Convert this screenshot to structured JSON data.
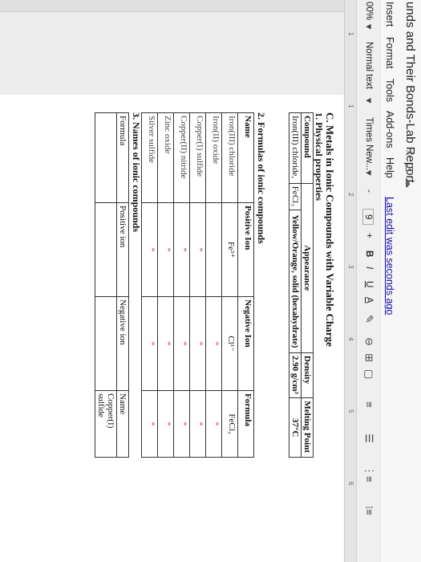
{
  "title_bar": {
    "doc_title": "unds and Their Bonds-Lab Report",
    "icons": [
      "star-icon",
      "move-to-folder-icon",
      "cloud-status-icon"
    ]
  },
  "menu": {
    "items": [
      "Insert",
      "Format",
      "Tools",
      "Add-ons",
      "Help"
    ],
    "last_edit": "Last edit was seconds ago"
  },
  "toolbar": {
    "zoom": "00%",
    "style": "Normal text",
    "font": "Times New...",
    "minus": "-",
    "font_size": "9",
    "plus": "+",
    "bold": "B",
    "italic": "I",
    "underline": "U",
    "text_color": "A"
  },
  "ruler": {
    "ticks": [
      "1",
      "1",
      "2",
      "3",
      "4",
      "5",
      "6"
    ]
  },
  "section": {
    "title": "C. Metals in Ionic Compounds with Variable Charge",
    "physical_title": "1. Physical properties",
    "physical_headers": [
      "Compound",
      "Appearance",
      "Density",
      "Melting Point"
    ],
    "physical_row": {
      "compound": "Iron(III) chloride,",
      "formula": "FeCl₃",
      "appearance": "Yellow/Orange, solid (hexahydrate)",
      "density": "2.90 g/cm³",
      "melting_point": "37°C"
    },
    "formulas_title": "2. Formulas of ionic compounds",
    "formulas_headers": [
      "Name",
      "Positive Ion",
      "Negative Ion",
      "Formula"
    ],
    "formulas_rows": [
      {
        "name": "Iron(III) chloride",
        "pos": "Fe³⁺",
        "neg": "Cl¹⁻",
        "formula": "FeCl₃"
      },
      {
        "name": "Iron(II) oxide",
        "pos": "",
        "neg": "*",
        "formula": "*"
      },
      {
        "name": "Copper(I) sulfide",
        "pos": "*",
        "neg": "*",
        "formula": "*"
      },
      {
        "name": "Copper(II) nitride",
        "pos": "*",
        "neg": "*",
        "formula": "*"
      },
      {
        "name": "Zinc oxide",
        "pos": "*",
        "neg": "*",
        "formula": "*"
      },
      {
        "name": "Silver sulfide",
        "pos": "*",
        "neg": "*",
        "formula": "*"
      }
    ],
    "names_title": "3. Names of ionic compounds",
    "names_headers": [
      "Formula",
      "Positive ion",
      "Negative ion",
      "Name"
    ],
    "names_first_row_partial": "Copper(I) sulfide"
  },
  "colors": {
    "placeholder": "#e04848",
    "link": "#1a0dab"
  }
}
